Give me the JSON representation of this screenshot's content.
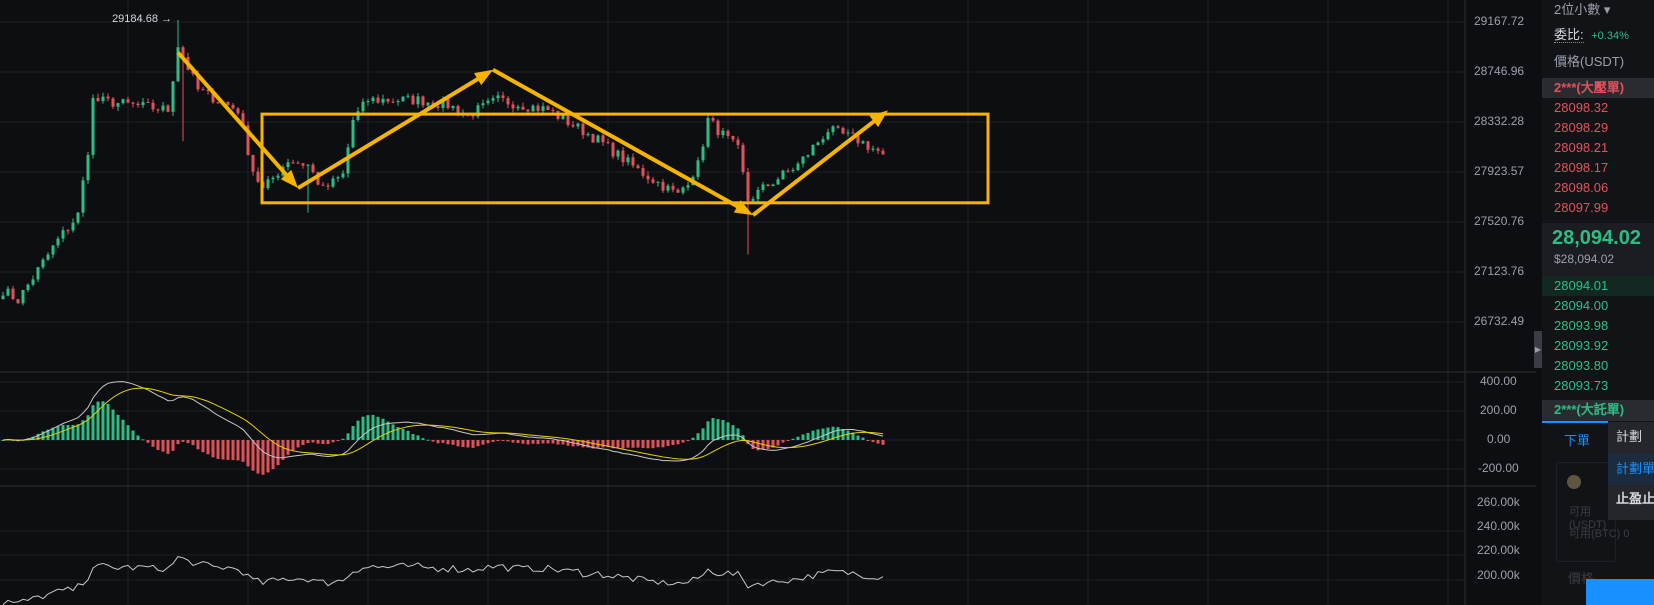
{
  "colors": {
    "up": "#2ebd85",
    "down": "#e0525a",
    "annotation": "#f5b400",
    "bg": "#0d0e11",
    "grid": "#1e2025",
    "macd_dif": "#c8c8c8",
    "macd_dea": "#e8d000",
    "accent": "#1890ff"
  },
  "chart": {
    "high_marker": "29184.68 →",
    "price_axis": [
      "29167.72",
      "28746.96",
      "28332.28",
      "27923.57",
      "27520.76",
      "27123.76",
      "26732.49"
    ],
    "macd_axis": [
      "400.00",
      "200.00",
      "0.00",
      "-200.00"
    ],
    "volume_axis": [
      "260.00k",
      "240.00k",
      "220.00k",
      "200.00k"
    ]
  },
  "chart_data": {
    "type": "candlestick",
    "price_path": [
      [
        0,
        26992
      ],
      [
        3,
        26911
      ],
      [
        11,
        27398
      ],
      [
        15,
        27601
      ],
      [
        17,
        28129
      ],
      [
        18,
        28535
      ],
      [
        33,
        28454
      ],
      [
        35,
        28981
      ],
      [
        39,
        28616
      ],
      [
        47,
        28454
      ],
      [
        50,
        27966
      ],
      [
        52,
        27804
      ],
      [
        57,
        28048
      ],
      [
        61,
        28007
      ],
      [
        64,
        27804
      ],
      [
        68,
        27926
      ],
      [
        70,
        28372
      ],
      [
        73,
        28535
      ],
      [
        83,
        28535
      ],
      [
        89,
        28494
      ],
      [
        93,
        28413
      ],
      [
        99,
        28535
      ],
      [
        109,
        28454
      ],
      [
        119,
        28210
      ],
      [
        127,
        27966
      ],
      [
        135,
        27763
      ],
      [
        139,
        28007
      ],
      [
        141,
        28372
      ],
      [
        147,
        28129
      ],
      [
        149,
        27723
      ],
      [
        153,
        27845
      ],
      [
        159,
        28007
      ],
      [
        165,
        28291
      ],
      [
        171,
        28210
      ],
      [
        176,
        28094
      ]
    ],
    "high": 29184.68,
    "ylim": [
      26732.49,
      29167.72
    ],
    "annotations": {
      "range_box": [
        28420,
        27700
      ],
      "arrows": [
        [
          35,
          28920,
          59,
          27820
        ],
        [
          59,
          27820,
          98,
          28780
        ],
        [
          98,
          28780,
          150,
          27600
        ],
        [
          150,
          27600,
          177,
          28450
        ]
      ]
    }
  },
  "panel": {
    "precision": "2位小數 ▾",
    "ratio_label": "委比:",
    "ratio_value": "+0.34%",
    "price_header": "價格(USDT)",
    "ask_banner": "2***(大壓單)",
    "asks": [
      "28098.32",
      "28098.29",
      "28098.21",
      "28098.17",
      "28098.06",
      "28097.99"
    ],
    "last_price": "28,094.02",
    "last_price_usd": "$28,094.02",
    "bids": [
      "28094.01",
      "28094.00",
      "28093.98",
      "28093.92",
      "28093.80",
      "28093.73"
    ],
    "bid_banner": "2***(大託單)",
    "tab_order": "下單",
    "menu": [
      "計劃",
      "計劃單",
      "止盈止"
    ],
    "avail_usdt": "可用(USDT)",
    "avail_btc": "可用(BTC) 0",
    "price_label": "價格"
  }
}
